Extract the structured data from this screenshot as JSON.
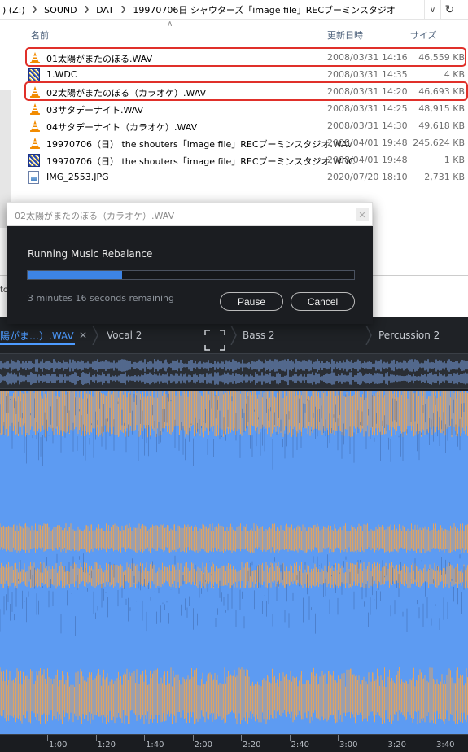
{
  "explorer": {
    "breadcrumb": [
      ") (Z:)",
      "SOUND",
      "DAT",
      "19970706日 シャウターズ「image file」RECブーミンスタジオ"
    ],
    "columns": {
      "name": "名前",
      "modified": "更新日時",
      "size": "サイズ"
    },
    "files": [
      {
        "name": "01太陽がまたのぼる.WAV",
        "date": "2008/03/31 14:16",
        "size": "46,559 KB",
        "icon": "vlc-cone-icon",
        "highlighted": true
      },
      {
        "name": "1.WDC",
        "date": "2008/03/31 14:35",
        "size": "4 KB",
        "icon": "wdc-file-icon",
        "highlighted": false
      },
      {
        "name": "02太陽がまたのぼる（カラオケ）.WAV",
        "date": "2008/03/31 14:20",
        "size": "46,693 KB",
        "icon": "vlc-cone-icon",
        "highlighted": true
      },
      {
        "name": "03サタデーナイト.WAV",
        "date": "2008/03/31 14:25",
        "size": "48,915 KB",
        "icon": "vlc-cone-icon",
        "highlighted": false
      },
      {
        "name": "04サタデーナイト（カラオケ）.WAV",
        "date": "2008/03/31 14:30",
        "size": "49,618 KB",
        "icon": "vlc-cone-icon",
        "highlighted": false
      },
      {
        "name": "19970706（日） the shouters「image file」RECブーミンスタジオ.WAV",
        "date": "2008/04/01 19:48",
        "size": "245,624 KB",
        "icon": "vlc-cone-icon",
        "highlighted": false
      },
      {
        "name": "19970706（日） the shouters「image file」RECブーミンスタジオ.WDC",
        "date": "2008/04/01 19:48",
        "size": "1 KB",
        "icon": "wdc-file-icon",
        "highlighted": false
      },
      {
        "name": "IMG_2553.JPG",
        "date": "2020/07/20 18:10",
        "size": "2,731 KB",
        "icon": "jpg-file-icon",
        "highlighted": false
      }
    ]
  },
  "background_window": {
    "partial_text": "to"
  },
  "dialog": {
    "title": "02太陽がまたのぼる（カラオケ）.WAV",
    "heading": "Running Music Rebalance",
    "progress": 0.29,
    "remaining": "3 minutes 16 seconds remaining",
    "pause_label": "Pause",
    "cancel_label": "Cancel"
  },
  "editor": {
    "tabs": [
      {
        "label": "陽がま…）.WAV",
        "active": true
      },
      {
        "label": "Vocal 2",
        "active": false
      },
      {
        "label": "Bass 2",
        "active": false
      },
      {
        "label": "Percussion 2",
        "active": false
      }
    ],
    "timeline": [
      "1:00",
      "1:20",
      "1:40",
      "2:00",
      "2:20",
      "2:40",
      "3:00",
      "3:20",
      "3:40"
    ],
    "colors": {
      "waveform_blue": "#5d9bf2",
      "spectral_orange": "#e8a45a",
      "accent": "#4d9bff"
    }
  }
}
